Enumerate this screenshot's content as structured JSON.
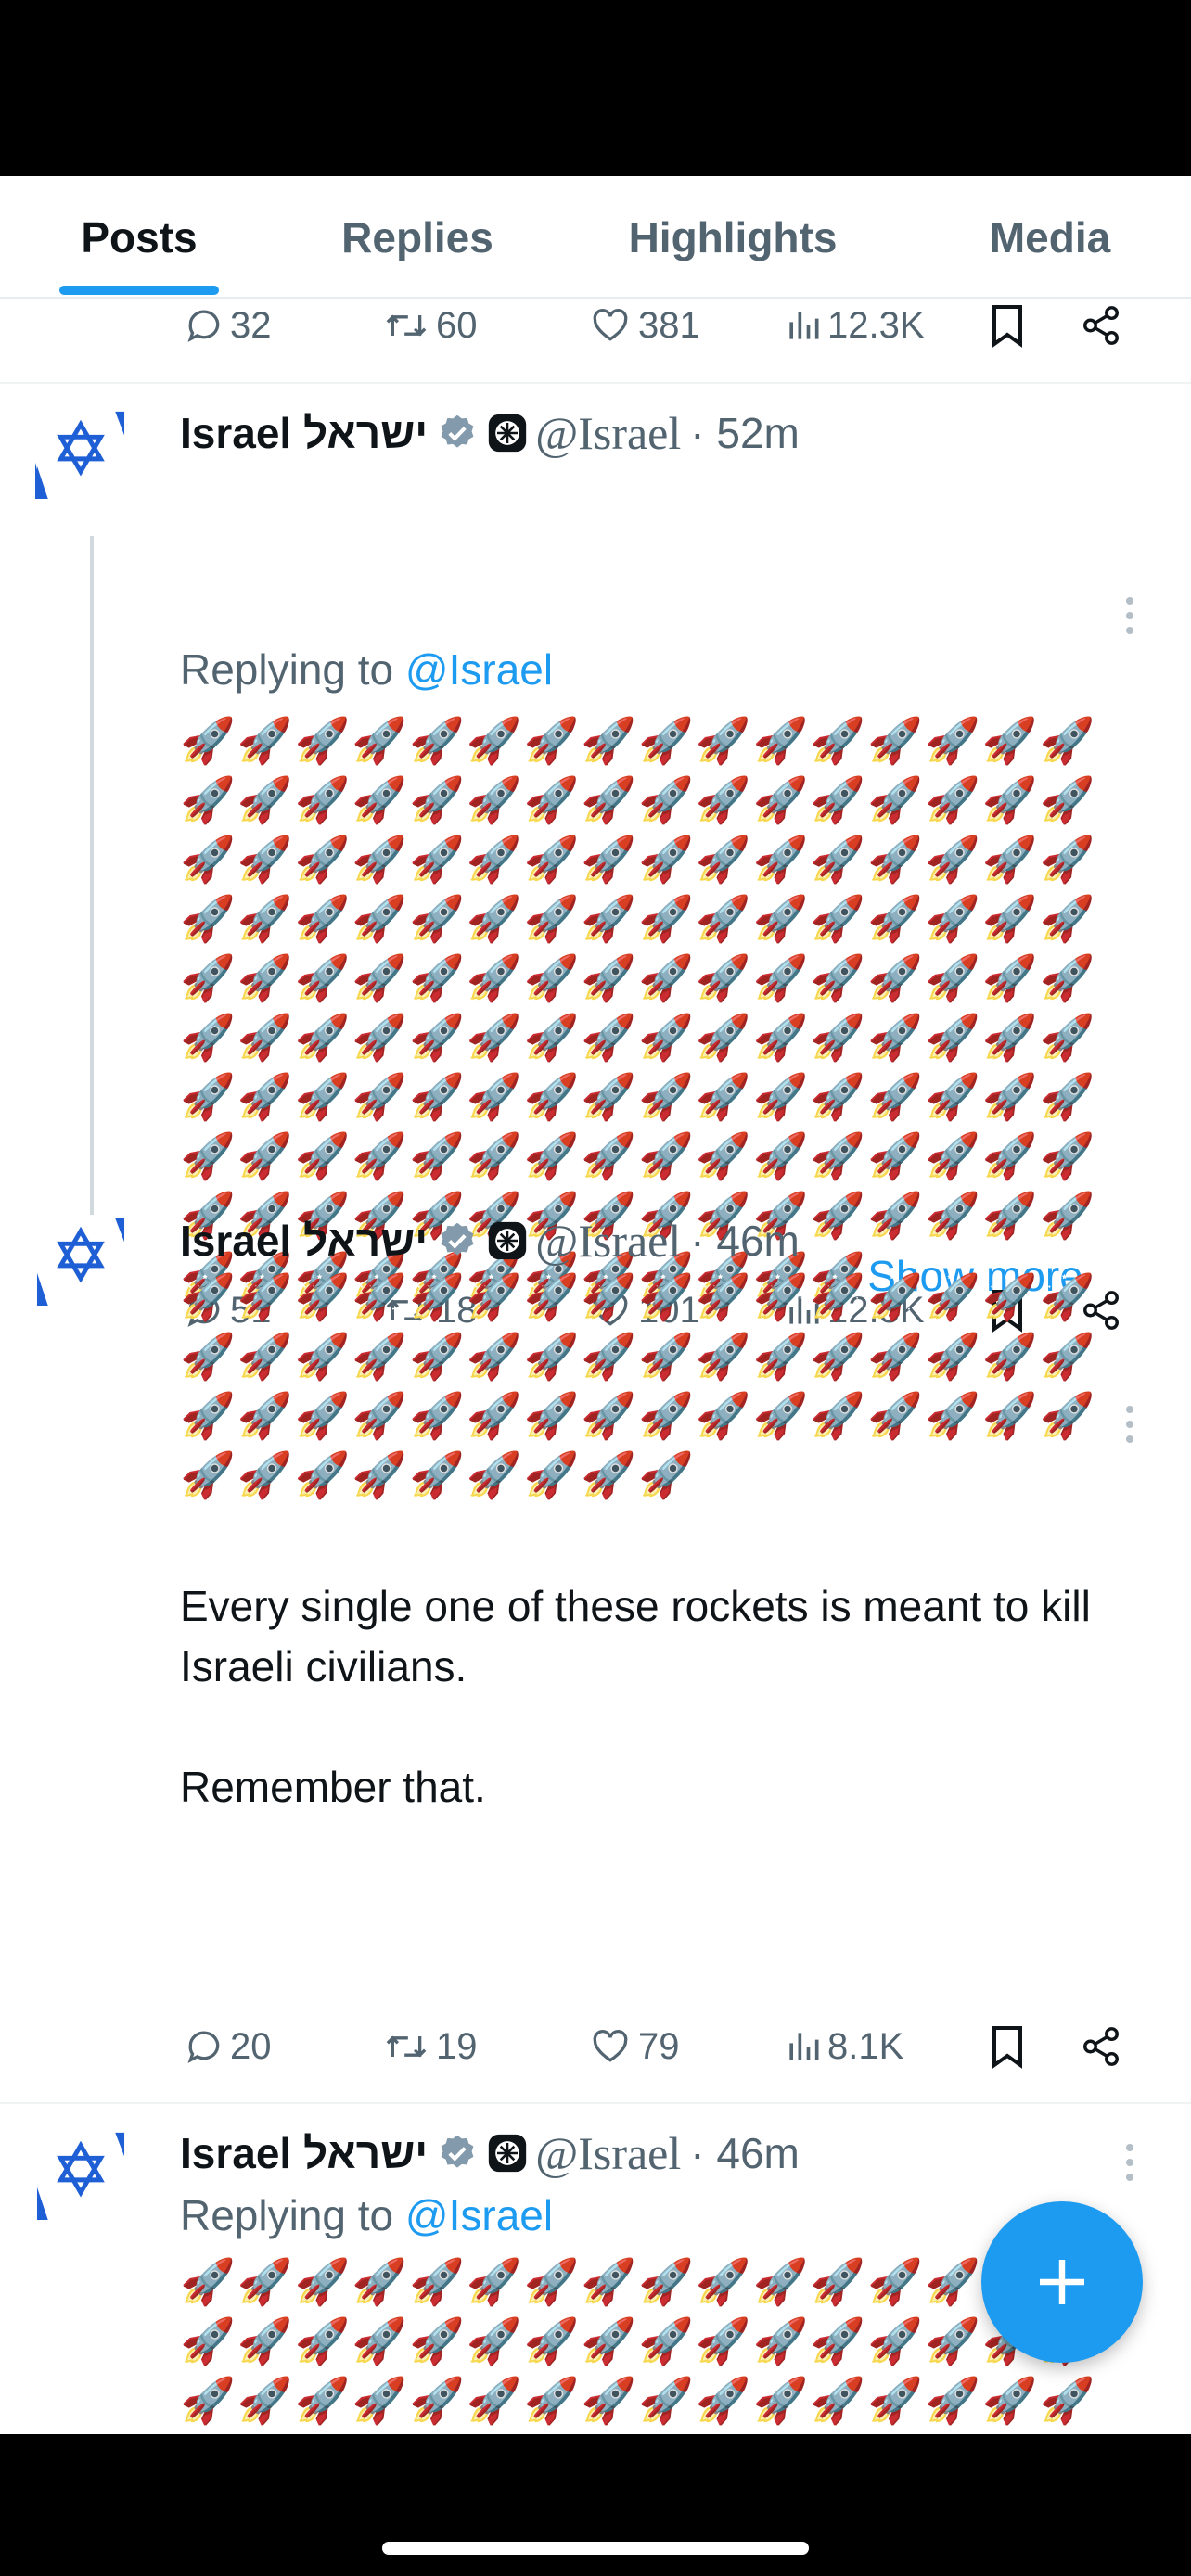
{
  "tabs": [
    "Posts",
    "Replies",
    "Highlights",
    "Media"
  ],
  "active_tab": "Posts",
  "top_actions": {
    "replies": "32",
    "reposts": "60",
    "likes": "381",
    "views": "12.3K"
  },
  "tweets": [
    {
      "name": "Israel ישראל",
      "handle": "@Israel",
      "time": "· 52m",
      "replying_prefix": "Replying to",
      "replying_to": "@Israel",
      "rockets": "🚀🚀🚀🚀🚀🚀🚀🚀🚀🚀🚀🚀🚀🚀🚀🚀🚀🚀🚀🚀🚀🚀🚀🚀🚀🚀🚀🚀🚀🚀🚀🚀🚀🚀🚀🚀🚀🚀🚀🚀🚀🚀🚀🚀🚀🚀🚀🚀🚀🚀🚀🚀🚀🚀🚀🚀🚀🚀🚀🚀🚀🚀🚀🚀🚀🚀🚀🚀🚀🚀🚀🚀🚀🚀🚀🚀🚀🚀🚀🚀🚀🚀🚀🚀🚀🚀🚀🚀🚀🚀🚀🚀🚀🚀🚀🚀🚀🚀🚀🚀🚀🚀🚀🚀🚀🚀🚀🚀🚀🚀🚀🚀🚀🚀🚀🚀🚀🚀🚀🚀🚀🚀🚀🚀🚀🚀🚀🚀🚀🚀🚀🚀🚀🚀🚀🚀🚀🚀🚀🚀🚀🚀🚀🚀🚀🚀🚀🚀🚀🚀🚀🚀🚀🚀🚀🚀",
      "show_more": "Show more",
      "actions": {
        "replies": "51",
        "reposts": "18",
        "likes": "101",
        "views": "12.3K"
      }
    },
    {
      "name": "Israel ישראל",
      "handle": "@Israel",
      "time": "· 46m",
      "rockets": "🚀🚀🚀🚀🚀🚀🚀🚀🚀🚀🚀🚀🚀🚀🚀🚀🚀🚀🚀🚀🚀🚀🚀🚀🚀🚀🚀🚀🚀🚀🚀🚀🚀🚀🚀🚀🚀🚀🚀🚀🚀🚀🚀🚀🚀🚀🚀🚀🚀🚀🚀🚀🚀🚀🚀🚀🚀",
      "text1": "Every single one of these rockets is meant to kill Israeli civilians.",
      "text2": "Remember that.",
      "actions": {
        "replies": "20",
        "reposts": "19",
        "likes": "79",
        "views": "8.1K"
      }
    },
    {
      "name": "Israel ישראל",
      "handle": "@Israel",
      "time": "· 46m",
      "replying_prefix": "Replying to",
      "replying_to": "@Israel",
      "rockets": "🚀🚀🚀🚀🚀🚀🚀🚀🚀🚀🚀🚀🚀🚀🚀🚀🚀🚀🚀🚀🚀🚀🚀🚀🚀🚀🚀🚀🚀🚀🚀🚀🚀🚀🚀🚀🚀🚀🚀🚀🚀🚀🚀🚀🚀🚀🚀🚀🚀🚀🚀🚀🚀🚀🚀🚀🚀🚀🚀🚀🚀🚀🚀🚀🚀🚀🚀🚀🚀🚀🚀🚀🚀🚀🚀🚀🚀🚀🚀🚀🚀🚀🚀🚀🚀🚀🚀🚀🚀🚀🚀🚀🚀🚀🚀🚀🚀🚀🚀🚀🚀🚀🚀🚀🚀🚀🚀🚀"
    }
  ],
  "colors": {
    "accent": "#1d9bf0",
    "text": "#0f1419",
    "muted": "#536471",
    "verified": "#829aab",
    "flag_blue": "#1f5fd6"
  },
  "icons": [
    "reply-icon",
    "repost-icon",
    "like-icon",
    "views-icon",
    "bookmark-icon",
    "share-icon",
    "verified-badge-icon",
    "affiliate-badge-icon",
    "more-icon",
    "compose-plus-icon"
  ]
}
